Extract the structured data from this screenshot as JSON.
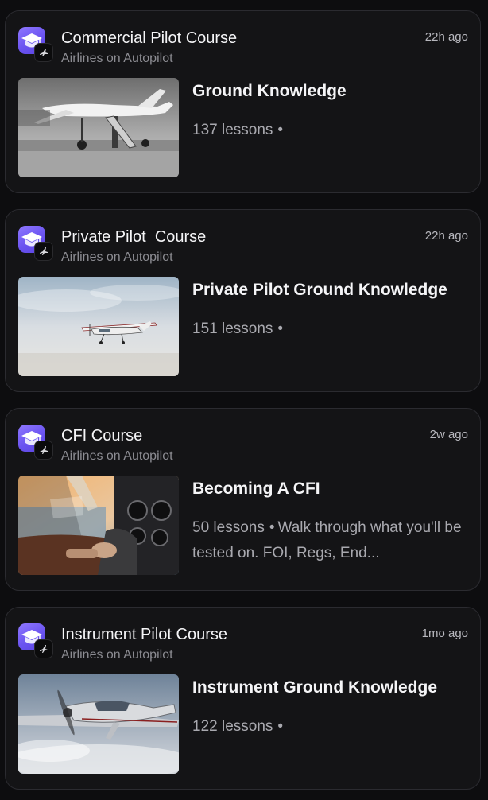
{
  "cards": [
    {
      "title": "Commercial Pilot Course",
      "author": "Airlines on Autopilot",
      "time": "22h ago",
      "lesson_title": "Ground Knowledge",
      "lesson_count": "137 lessons",
      "separator": "•",
      "description": ""
    },
    {
      "title": "Private Pilot  Course",
      "author": "Airlines on Autopilot",
      "time": "22h ago",
      "lesson_title": "Private Pilot Ground Knowledge",
      "lesson_count": "151 lessons",
      "separator": "•",
      "description": ""
    },
    {
      "title": "CFI Course",
      "author": "Airlines on Autopilot",
      "time": "2w ago",
      "lesson_title": "Becoming A CFI",
      "lesson_count": "50 lessons",
      "separator": "•",
      "description": "Walk through what you'll be tested on. FOI, Regs, End..."
    },
    {
      "title": "Instrument Pilot Course",
      "author": "Airlines on Autopilot",
      "time": "1mo ago",
      "lesson_title": "Instrument Ground Knowledge",
      "lesson_count": "122 lessons",
      "separator": "•",
      "description": ""
    }
  ],
  "icons": {
    "app": "graduation-cap-icon",
    "badge": "airplane-icon"
  },
  "colors": {
    "background": "#0d0d0f",
    "card": "#141416",
    "accent": "#7b63f7",
    "muted": "#8c8c92"
  }
}
